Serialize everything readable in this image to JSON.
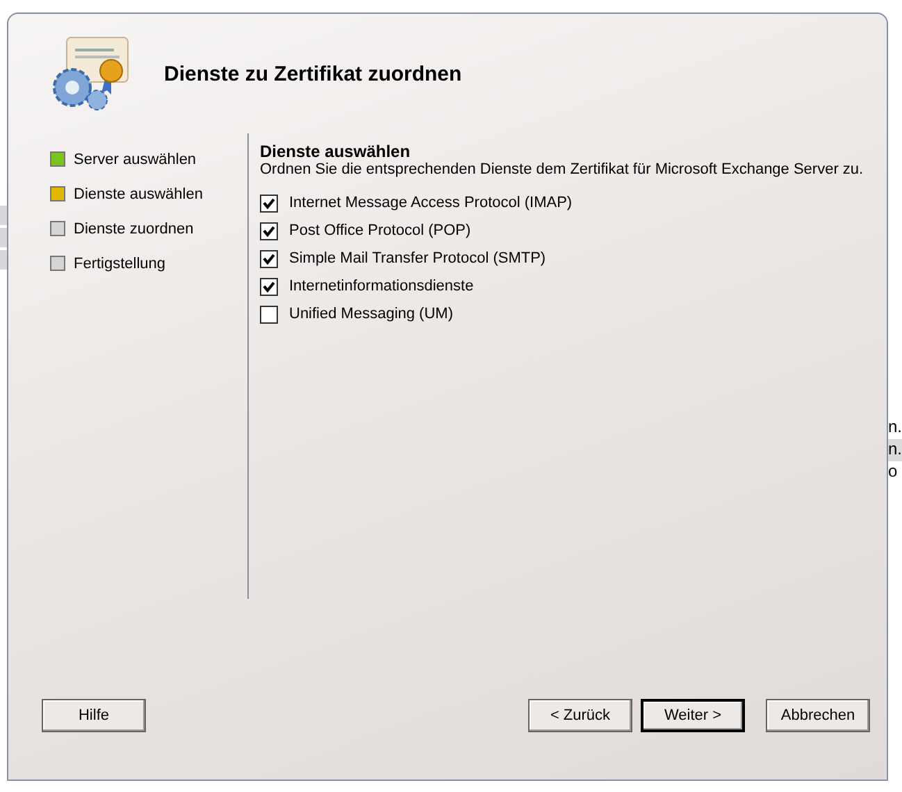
{
  "window": {
    "title": "Dienste zu Zertifikat zuordnen"
  },
  "steps": [
    {
      "label": "Server auswählen",
      "color": "#7ac41e"
    },
    {
      "label": "Dienste auswählen",
      "color": "#e0b800"
    },
    {
      "label": "Dienste zuordnen",
      "color": "#d4d4d4"
    },
    {
      "label": "Fertigstellung",
      "color": "#d4d4d4"
    }
  ],
  "section": {
    "title": "Dienste auswählen",
    "description": "Ordnen Sie die entsprechenden Dienste dem Zertifikat für Microsoft Exchange Server zu."
  },
  "services": [
    {
      "label": "Internet Message Access Protocol (IMAP)",
      "checked": true
    },
    {
      "label": "Post Office Protocol (POP)",
      "checked": true
    },
    {
      "label": "Simple Mail Transfer Protocol (SMTP)",
      "checked": true
    },
    {
      "label": "Internetinformationsdienste",
      "checked": true
    },
    {
      "label": "Unified Messaging (UM)",
      "checked": false
    }
  ],
  "help_button": "Hilfe",
  "buttons": [
    {
      "label": "< Zurück",
      "default": false
    },
    {
      "label": "Weiter >",
      "default": true
    },
    {
      "label": "Abbrechen",
      "default": false
    }
  ],
  "background_fragments": [
    "n.",
    "n.",
    "o"
  ]
}
